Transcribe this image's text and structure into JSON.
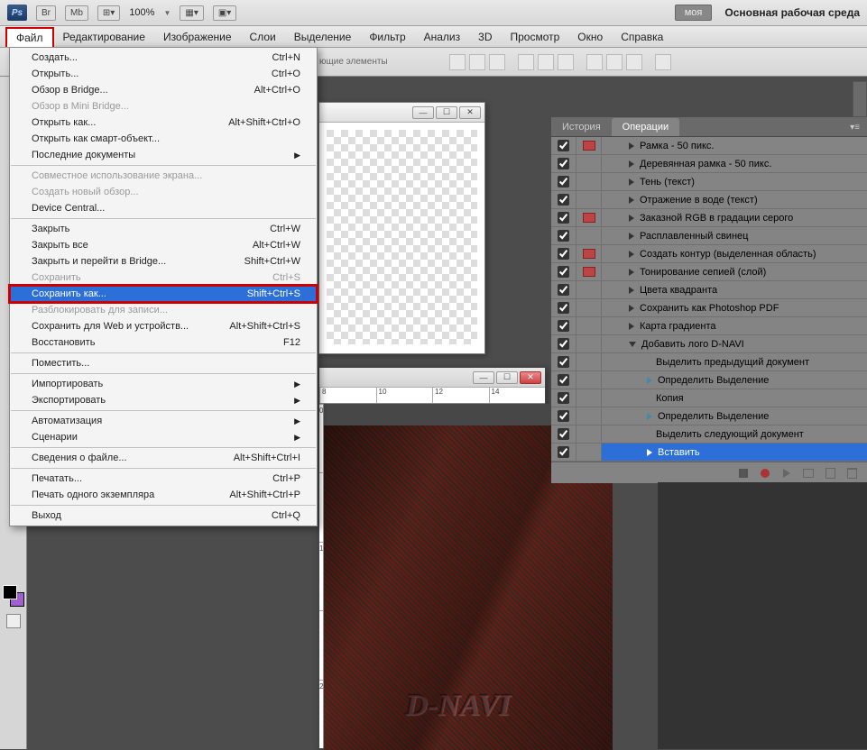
{
  "appbar": {
    "ps": "Ps",
    "br": "Br",
    "mb": "Mb",
    "zoom": "100%",
    "workspace_btn": "моя",
    "workspace_label": "Основная рабочая среда"
  },
  "menubar": [
    "Файл",
    "Редактирование",
    "Изображение",
    "Слои",
    "Выделение",
    "Фильтр",
    "Анализ",
    "3D",
    "Просмотр",
    "Окно",
    "Справка"
  ],
  "toolbar2": {
    "label": "ющие элементы"
  },
  "file_menu": [
    {
      "t": "item",
      "label": "Создать...",
      "sc": "Ctrl+N"
    },
    {
      "t": "item",
      "label": "Открыть...",
      "sc": "Ctrl+O"
    },
    {
      "t": "item",
      "label": "Обзор в Bridge...",
      "sc": "Alt+Ctrl+O"
    },
    {
      "t": "item",
      "label": "Обзор в Mini Bridge...",
      "disabled": true
    },
    {
      "t": "item",
      "label": "Открыть как...",
      "sc": "Alt+Shift+Ctrl+O"
    },
    {
      "t": "item",
      "label": "Открыть как смарт-объект..."
    },
    {
      "t": "item",
      "label": "Последние документы",
      "sub": true
    },
    {
      "t": "sep"
    },
    {
      "t": "item",
      "label": "Совместное использование экрана...",
      "disabled": true
    },
    {
      "t": "item",
      "label": "Создать новый обзор...",
      "disabled": true
    },
    {
      "t": "item",
      "label": "Device Central..."
    },
    {
      "t": "sep"
    },
    {
      "t": "item",
      "label": "Закрыть",
      "sc": "Ctrl+W"
    },
    {
      "t": "item",
      "label": "Закрыть все",
      "sc": "Alt+Ctrl+W"
    },
    {
      "t": "item",
      "label": "Закрыть и перейти в Bridge...",
      "sc": "Shift+Ctrl+W"
    },
    {
      "t": "item",
      "label": "Сохранить",
      "sc": "Ctrl+S",
      "disabled": true
    },
    {
      "t": "item",
      "label": "Сохранить как...",
      "sc": "Shift+Ctrl+S",
      "hl": true,
      "boxed": true
    },
    {
      "t": "item",
      "label": "Разблокировать для записи...",
      "disabled": true
    },
    {
      "t": "item",
      "label": "Сохранить для Web и устройств...",
      "sc": "Alt+Shift+Ctrl+S"
    },
    {
      "t": "item",
      "label": "Восстановить",
      "sc": "F12"
    },
    {
      "t": "sep"
    },
    {
      "t": "item",
      "label": "Поместить..."
    },
    {
      "t": "sep"
    },
    {
      "t": "item",
      "label": "Импортировать",
      "sub": true
    },
    {
      "t": "item",
      "label": "Экспортировать",
      "sub": true
    },
    {
      "t": "sep"
    },
    {
      "t": "item",
      "label": "Автоматизация",
      "sub": true
    },
    {
      "t": "item",
      "label": "Сценарии",
      "sub": true
    },
    {
      "t": "sep"
    },
    {
      "t": "item",
      "label": "Сведения о файле...",
      "sc": "Alt+Shift+Ctrl+I"
    },
    {
      "t": "sep"
    },
    {
      "t": "item",
      "label": "Печатать...",
      "sc": "Ctrl+P"
    },
    {
      "t": "item",
      "label": "Печать одного экземпляра",
      "sc": "Alt+Shift+Ctrl+P"
    },
    {
      "t": "sep"
    },
    {
      "t": "item",
      "label": "Выход",
      "sc": "Ctrl+Q"
    }
  ],
  "ruler_h": [
    "8",
    "10",
    "12",
    "14"
  ],
  "ruler_v": [
    "0",
    "",
    "1",
    "",
    "2"
  ],
  "emboss_text": "D-NAVI",
  "panel": {
    "tabs": [
      "История",
      "Операции"
    ],
    "rows": [
      {
        "chk": true,
        "mod": true,
        "indent": 20,
        "tri": "r",
        "label": "Рамка - 50 пикс."
      },
      {
        "chk": true,
        "mod": false,
        "indent": 20,
        "tri": "r",
        "label": "Деревянная рамка - 50 пикс."
      },
      {
        "chk": true,
        "mod": false,
        "indent": 20,
        "tri": "r",
        "label": "Тень (текст)"
      },
      {
        "chk": true,
        "mod": false,
        "indent": 20,
        "tri": "r",
        "label": "Отражение в воде (текст)"
      },
      {
        "chk": true,
        "mod": true,
        "indent": 20,
        "tri": "r",
        "label": "Заказной RGB в градации серого"
      },
      {
        "chk": true,
        "mod": false,
        "indent": 20,
        "tri": "r",
        "label": "Расплавленный свинец"
      },
      {
        "chk": true,
        "mod": true,
        "indent": 20,
        "tri": "r",
        "label": "Создать контур (выделенная область)"
      },
      {
        "chk": true,
        "mod": true,
        "indent": 20,
        "tri": "r",
        "label": "Тонирование сепией (слой)"
      },
      {
        "chk": true,
        "mod": false,
        "indent": 20,
        "tri": "r",
        "label": "Цвета квадранта"
      },
      {
        "chk": true,
        "mod": false,
        "indent": 20,
        "tri": "r",
        "label": "Сохранить как Photoshop PDF"
      },
      {
        "chk": true,
        "mod": false,
        "indent": 20,
        "tri": "r",
        "label": "Карта градиента"
      },
      {
        "chk": true,
        "mod": false,
        "indent": 20,
        "tri": "d",
        "label": "Добавить лого D-NAVI"
      },
      {
        "chk": true,
        "mod": false,
        "indent": 50,
        "tri": "",
        "label": "Выделить  предыдущий документ"
      },
      {
        "chk": true,
        "mod": false,
        "indent": 40,
        "tri": "rb",
        "label": "Определить Выделение"
      },
      {
        "chk": true,
        "mod": false,
        "indent": 50,
        "tri": "",
        "label": "Копия"
      },
      {
        "chk": true,
        "mod": false,
        "indent": 40,
        "tri": "rb",
        "label": "Определить Выделение"
      },
      {
        "chk": true,
        "mod": false,
        "indent": 50,
        "tri": "",
        "label": "Выделить  следующий документ"
      },
      {
        "chk": true,
        "mod": false,
        "indent": 40,
        "tri": "rb",
        "label": "Вставить",
        "sel": true
      }
    ]
  }
}
